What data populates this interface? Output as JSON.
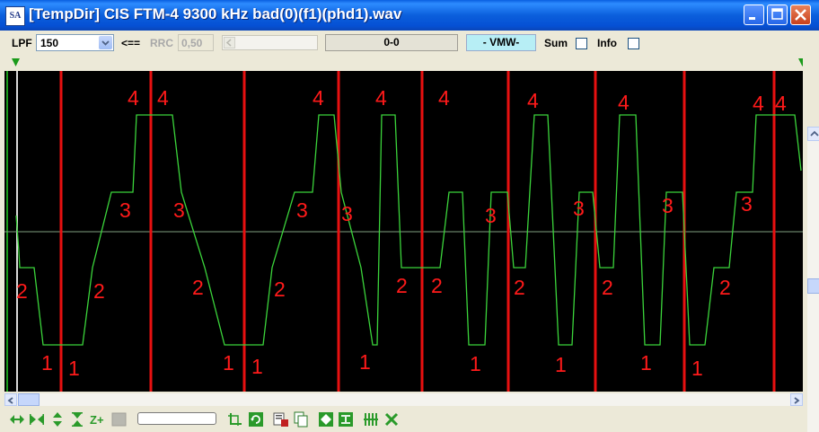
{
  "window": {
    "title": "[TempDir] CIS FTM-4 9300 kHz bad(0)(f1)(phd1).wav",
    "app_icon_text": "SA"
  },
  "toolbar": {
    "lpf_label": "LPF",
    "lpf_value": "150",
    "arrow_label": "<==",
    "rrc_label": "RRC",
    "rrc_value": "0,50",
    "counter_value": "0-0",
    "mode_value": "- VMW-",
    "sum_label": "Sum",
    "sum_checked": false,
    "info_label": "Info",
    "info_checked": false
  },
  "annotations": {
    "level_labels": [
      {
        "text": "4"
      },
      {
        "text": "4"
      },
      {
        "text": "4"
      },
      {
        "text": "4"
      },
      {
        "text": "4"
      },
      {
        "text": "4"
      },
      {
        "text": "4"
      },
      {
        "text": "4"
      },
      {
        "text": "4"
      },
      {
        "text": "3"
      },
      {
        "text": "3"
      },
      {
        "text": "3"
      },
      {
        "text": "3"
      },
      {
        "text": "3"
      },
      {
        "text": "3"
      },
      {
        "text": "3"
      },
      {
        "text": "3"
      },
      {
        "text": "2"
      },
      {
        "text": "2"
      },
      {
        "text": "2"
      },
      {
        "text": "2"
      },
      {
        "text": "2"
      },
      {
        "text": "2"
      },
      {
        "text": "2"
      },
      {
        "text": "2"
      },
      {
        "text": "2"
      },
      {
        "text": "1"
      },
      {
        "text": "1"
      },
      {
        "text": "1"
      },
      {
        "text": "1"
      },
      {
        "text": "1"
      },
      {
        "text": "1"
      },
      {
        "text": "1"
      },
      {
        "text": "1"
      },
      {
        "text": "1"
      }
    ]
  },
  "colors": {
    "trace": "#3bd43b",
    "marker": "#e81010",
    "label": "#ff1a1a",
    "center_line": "#7f9f7f",
    "background": "#000000",
    "handle": "#1a9a1a"
  },
  "icons": {
    "bottom_toolbar": [
      "expand-horizontal-icon",
      "collapse-horizontal-icon",
      "expand-vertical-icon",
      "collapse-vertical-icon",
      "zoom-plus-icon",
      "stop-icon",
      "crop-icon",
      "refresh-icon",
      "save-icon",
      "copy-icon",
      "diamond-icon",
      "fit-icon",
      "bars-icon",
      "cross-icon"
    ]
  }
}
